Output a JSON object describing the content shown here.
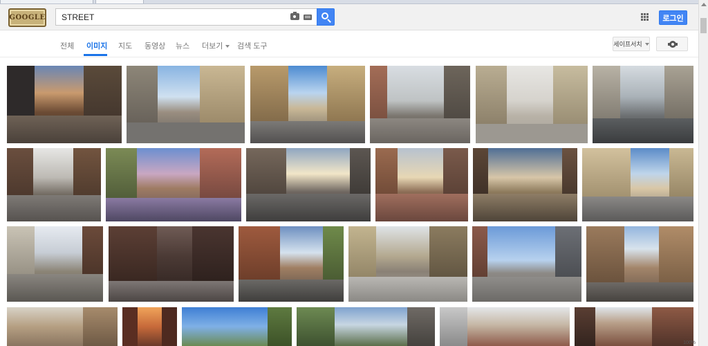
{
  "header": {
    "search_value": "STREET",
    "login_label": "로그인"
  },
  "nav": {
    "tabs": [
      {
        "label": "전체"
      },
      {
        "label": "이미지"
      },
      {
        "label": "지도"
      },
      {
        "label": "동영상"
      },
      {
        "label": "뉴스"
      },
      {
        "label": "더보기"
      },
      {
        "label": "검색 도구"
      }
    ],
    "active_index": 1,
    "safesearch_label": "세이프서치"
  },
  "statusbar": {
    "zoom": "100%"
  },
  "icons": {
    "camera": "camera-icon",
    "keyboard": "keyboard-icon",
    "search": "search-icon",
    "apps": "apps-grid-icon",
    "settings": "gear-icon"
  },
  "colors": {
    "accent": "#4285f4",
    "active_tab": "#1a73e8",
    "header_bg": "#f1f1f1"
  }
}
